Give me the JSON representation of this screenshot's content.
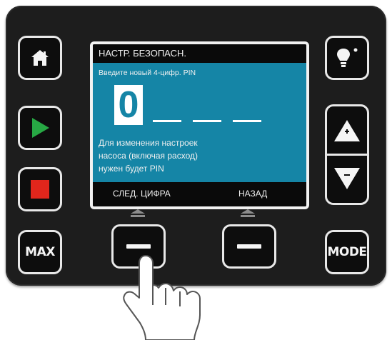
{
  "colors": {
    "panel": "#1d1d1d",
    "lcd_background": "#1585a6",
    "start_green": "#27a844",
    "stop_red": "#e1261c",
    "key_border": "#e8e8e8"
  },
  "left_keys": [
    {
      "name": "home-button",
      "icon": "home-icon"
    },
    {
      "name": "start-button",
      "icon": "play-icon"
    },
    {
      "name": "stop-button",
      "icon": "stop-icon"
    },
    {
      "name": "max-button",
      "label": "MAX"
    }
  ],
  "right_keys": {
    "light": {
      "icon": "lightbulb-icon"
    },
    "up": {
      "icon": "up-plus-icon"
    },
    "down": {
      "icon": "down-minus-icon"
    },
    "mode_label": "MODE"
  },
  "screen": {
    "title": "НАСТР. БЕЗОПАСН.",
    "prompt": "Введите новый 4-цифр. PIN",
    "pin": {
      "current_digit": "0",
      "remaining_digits": 3
    },
    "info_lines": [
      "Для изменения настроек",
      "насоса (включая расход)",
      "нужен будет PIN"
    ],
    "softkeys": {
      "left_label": "СЛЕД. ЦИФРА",
      "right_label": "НАЗАД"
    }
  },
  "pointer": {
    "icon": "pointing-hand-icon",
    "target": "left-softkey"
  }
}
